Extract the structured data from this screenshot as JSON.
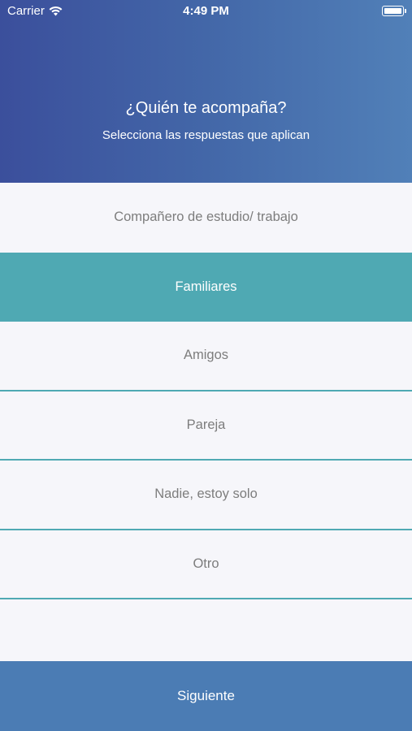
{
  "status_bar": {
    "carrier": "Carrier",
    "time": "4:49 PM"
  },
  "header": {
    "title": "¿Quién te acompaña?",
    "subtitle": "Selecciona las respuestas que aplican"
  },
  "options": [
    {
      "label": "Compañero de estudio/ trabajo",
      "selected": false
    },
    {
      "label": "Familiares",
      "selected": true
    },
    {
      "label": "Amigos",
      "selected": false
    },
    {
      "label": "Pareja",
      "selected": false
    },
    {
      "label": "Nadie, estoy solo",
      "selected": false
    },
    {
      "label": "Otro",
      "selected": false
    }
  ],
  "footer": {
    "next_label": "Siguiente"
  },
  "colors": {
    "header_gradient_start": "#3b4f9c",
    "header_gradient_end": "#5180b8",
    "selected_option": "#4fa9b3",
    "next_button": "#4b7cb4",
    "option_text": "#7d7d7d",
    "background": "#f6f6fa"
  }
}
